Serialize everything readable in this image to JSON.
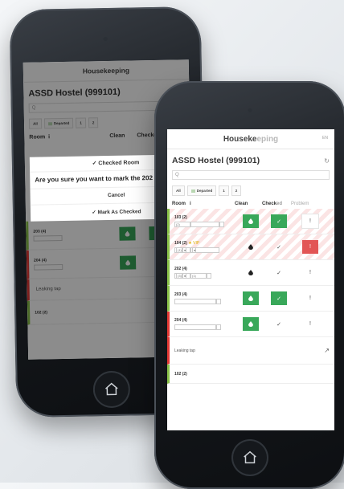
{
  "app": {
    "header_part1": "Houseke",
    "header_part2": "eping",
    "lang": "EN",
    "back_header": "Housekeeping"
  },
  "hostel": {
    "title": "ASSD Hostel (999101)"
  },
  "search": {
    "placeholder": "Q"
  },
  "filters": [
    {
      "label": "All"
    },
    {
      "label": "Departed"
    },
    {
      "label": "1"
    },
    {
      "label": "2"
    }
  ],
  "columns": {
    "room": "Room",
    "info": "i",
    "clean": "Clean",
    "checked": "Checked",
    "checked_a": "Check",
    "checked_b": "ed",
    "problem": "Problem"
  },
  "rows": [
    {
      "room": "103 (2)",
      "box1": "(2)",
      "clean": "drop",
      "checked": "✓",
      "problem": "!"
    },
    {
      "room": "104 (2)",
      "vip": "★ VIP",
      "box1": "(1)",
      "clean": "drop",
      "checked": "✓",
      "problem": "!"
    },
    {
      "room": "202 (4)",
      "box1": "(3)",
      "box2": "(1)",
      "clean": "drop",
      "checked": "✓",
      "problem": "!"
    },
    {
      "room": "203 (4)",
      "clean": "drop",
      "checked": "✓",
      "problem": "!"
    },
    {
      "room": "204 (4)",
      "clean": "drop",
      "checked": "✓",
      "problem": "!"
    },
    {
      "room": "102 (2)"
    }
  ],
  "note": {
    "text": "Leaking tap",
    "icon": "wrench-icon"
  },
  "modal": {
    "header": "✓ Checked Room",
    "question": "Are you sure you want to mark the 202 ' as checked?",
    "cancel": "Cancel",
    "confirm": "✓ Mark As Checked"
  },
  "back_rows": [
    {
      "room": "203 (4)"
    },
    {
      "room": "204 (4)"
    },
    {
      "room": "102 (2)"
    }
  ],
  "colors": {
    "green": "#39a85a",
    "red": "#e25555",
    "accent_line_green": "#8bc34a",
    "accent_line_red": "#e53935"
  }
}
